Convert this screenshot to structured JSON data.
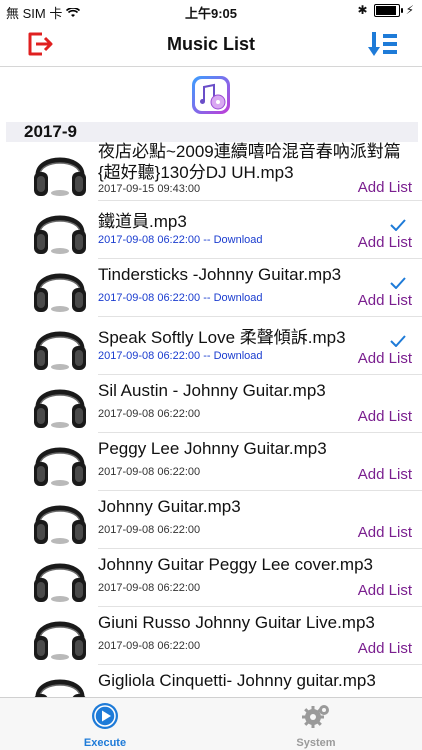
{
  "status_bar": {
    "carrier": "無 SIM 卡",
    "time": "上午9:05"
  },
  "header": {
    "title": "Music List",
    "exit_icon": "exit-icon",
    "sort_icon": "sort-list-icon"
  },
  "section": {
    "label": "2017-9"
  },
  "rows": [
    {
      "title": "夜店必點~2009連續嘻哈混音春吶派對篇{超好聽}130分DJ UH.mp3",
      "meta": "2017-09-15 09:43:00",
      "add": "Add List"
    },
    {
      "title": "鐵道員.mp3",
      "meta": "2017-09-08 06:22:00 -- Download",
      "add": "Add List"
    },
    {
      "title": "Tindersticks -Johnny Guitar.mp3",
      "meta": "2017-09-08 06:22:00 -- Download",
      "add": "Add List"
    },
    {
      "title": "Speak Softly Love 柔聲傾訴.mp3",
      "meta": "2017-09-08 06:22:00 -- Download",
      "add": "Add List"
    },
    {
      "title": "Sil Austin - Johnny Guitar.mp3",
      "meta": "2017-09-08 06:22:00",
      "add": "Add List"
    },
    {
      "title": "Peggy Lee Johnny Guitar.mp3",
      "meta": "2017-09-08 06:22:00",
      "add": "Add List"
    },
    {
      "title": "Johnny Guitar.mp3",
      "meta": "2017-09-08 06:22:00",
      "add": "Add List"
    },
    {
      "title": "Johnny Guitar Peggy Lee cover.mp3",
      "meta": "2017-09-08 06:22:00",
      "add": "Add List"
    },
    {
      "title": "Giuni Russo Johnny Guitar Live.mp3",
      "meta": "2017-09-08 06:22:00",
      "add": "Add List"
    },
    {
      "title": "Gigliola Cinquetti- Johnny guitar.mp3",
      "meta": "",
      "add": ""
    }
  ],
  "tabs": [
    {
      "label": "Execute",
      "icon": "play-icon",
      "active": true
    },
    {
      "label": "System",
      "icon": "gear-icon",
      "active": false
    }
  ],
  "colors": {
    "accent": "#1e7bd8",
    "add_list": "#7a1f8f",
    "exit": "#e02020",
    "download": "#1a3ccf"
  }
}
